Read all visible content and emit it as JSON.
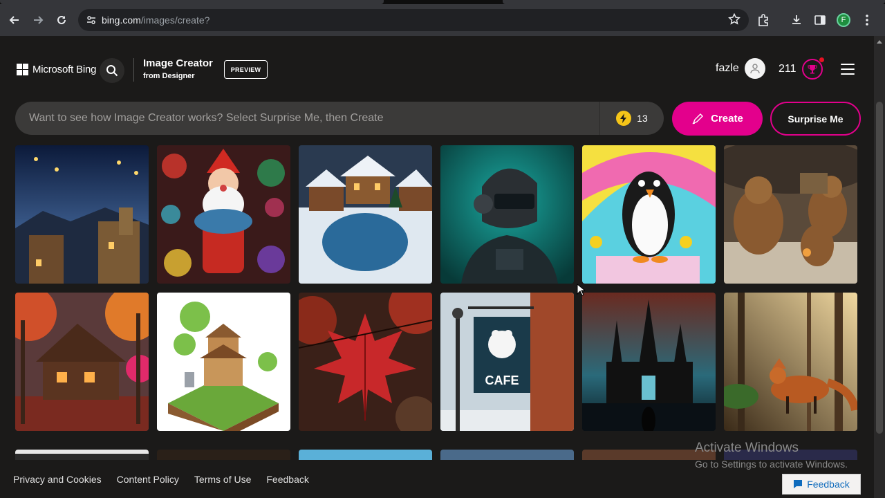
{
  "browser": {
    "url_host": "bing.com",
    "url_path": "/images/create?",
    "profile_initial": "F"
  },
  "header": {
    "brand": "Microsoft Bing",
    "title": "Image Creator",
    "subtitle": "from Designer",
    "badge": "PREVIEW",
    "username": "fazle",
    "reward_points": "211"
  },
  "prompt": {
    "placeholder": "Want to see how Image Creator works? Select Surprise Me, then Create",
    "boosts": "13",
    "create_label": "Create",
    "surprise_label": "Surprise Me"
  },
  "footer": {
    "links": [
      "Privacy and Cookies",
      "Content Policy",
      "Terms of Use",
      "Feedback"
    ],
    "feedback_button": "Feedback"
  },
  "watermark": {
    "line1": "Activate Windows",
    "line2": "Go to Settings to activate Windows."
  },
  "colors": {
    "accent": "#e3008c",
    "page_bg": "#1b1a19",
    "prompt_bg": "#3b3a39"
  }
}
